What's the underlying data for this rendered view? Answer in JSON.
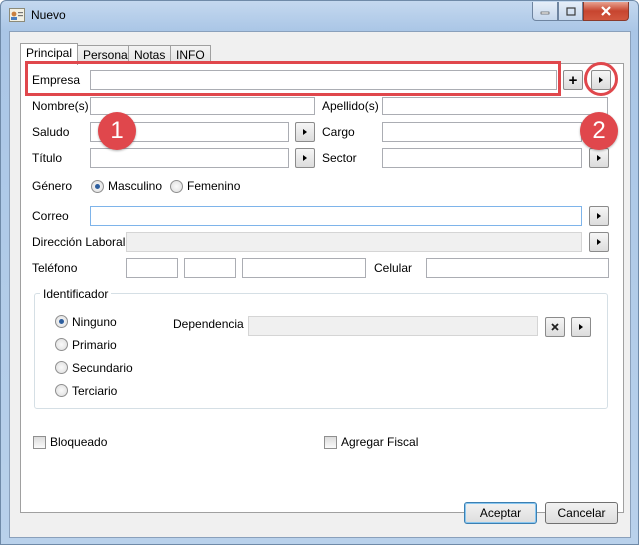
{
  "window": {
    "title": "Nuevo"
  },
  "tabs": [
    {
      "label": "Principal",
      "active": true
    },
    {
      "label": "Personal",
      "active": false
    },
    {
      "label": "Notas",
      "active": false
    },
    {
      "label": "INFO",
      "active": false
    }
  ],
  "form": {
    "empresa": {
      "label": "Empresa",
      "value": ""
    },
    "nombres": {
      "label": "Nombre(s)",
      "value": ""
    },
    "apellidos": {
      "label": "Apellido(s)",
      "value": ""
    },
    "saludo": {
      "label": "Saludo",
      "value": ""
    },
    "cargo": {
      "label": "Cargo",
      "value": ""
    },
    "titulo": {
      "label": "Título",
      "value": ""
    },
    "sector": {
      "label": "Sector",
      "value": ""
    },
    "genero": {
      "label": "Género",
      "options": [
        "Masculino",
        "Femenino"
      ],
      "selected": "Masculino"
    },
    "correo": {
      "label": "Correo",
      "value": ""
    },
    "direccion": {
      "label": "Dirección Laboral",
      "value": ""
    },
    "telefono": {
      "label": "Teléfono",
      "value": ""
    },
    "celular": {
      "label": "Celular",
      "value": ""
    },
    "identificador": {
      "label": "Identificador",
      "options": [
        "Ninguno",
        "Primario",
        "Secundario",
        "Terciario"
      ],
      "selected": "Ninguno",
      "dependencia_label": "Dependencia"
    },
    "bloqueado": {
      "label": "Bloqueado",
      "checked": false
    },
    "agregar_fiscal": {
      "label": "Agregar Fiscal",
      "checked": false
    }
  },
  "buttons": {
    "accept": "Aceptar",
    "cancel": "Cancelar",
    "add": "+"
  },
  "annotations": {
    "badge1": "1",
    "badge2": "2",
    "color": "#e0474c"
  }
}
